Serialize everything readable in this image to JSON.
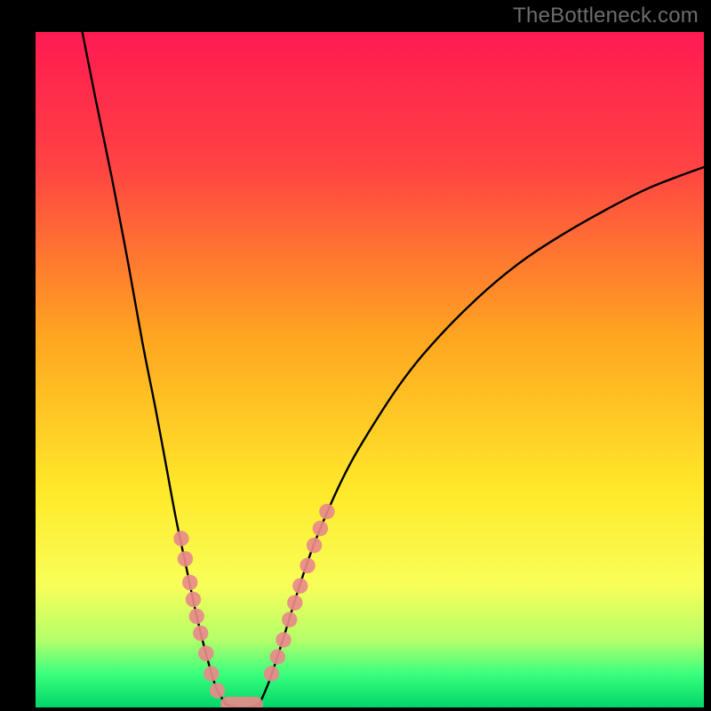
{
  "watermark": "TheBottleneck.com",
  "chart_data": {
    "type": "line",
    "title": "",
    "xlabel": "",
    "ylabel": "",
    "xlim": [
      0,
      100
    ],
    "ylim": [
      0,
      100
    ],
    "background_gradient_stops": [
      {
        "offset": 0,
        "color": "#ff1a52"
      },
      {
        "offset": 20,
        "color": "#ff4343"
      },
      {
        "offset": 45,
        "color": "#ffa520"
      },
      {
        "offset": 68,
        "color": "#ffe92a"
      },
      {
        "offset": 82,
        "color": "#f8ff59"
      },
      {
        "offset": 90,
        "color": "#b4ff6a"
      },
      {
        "offset": 95,
        "color": "#3bff7d"
      },
      {
        "offset": 100,
        "color": "#00d66a"
      }
    ],
    "series": [
      {
        "name": "left-branch",
        "type": "curve",
        "values": [
          {
            "x": 7.0,
            "y": 100.0
          },
          {
            "x": 9.0,
            "y": 90.0
          },
          {
            "x": 11.5,
            "y": 78.0
          },
          {
            "x": 14.0,
            "y": 65.0
          },
          {
            "x": 16.0,
            "y": 54.0
          },
          {
            "x": 18.0,
            "y": 44.0
          },
          {
            "x": 19.5,
            "y": 36.0
          },
          {
            "x": 21.0,
            "y": 28.0
          },
          {
            "x": 22.5,
            "y": 21.0
          },
          {
            "x": 24.0,
            "y": 14.0
          },
          {
            "x": 25.5,
            "y": 8.0
          },
          {
            "x": 27.0,
            "y": 3.0
          },
          {
            "x": 28.5,
            "y": 0.5
          }
        ]
      },
      {
        "name": "valley-floor",
        "type": "curve",
        "values": [
          {
            "x": 28.5,
            "y": 0.5
          },
          {
            "x": 30.0,
            "y": 0.0
          },
          {
            "x": 32.0,
            "y": 0.0
          },
          {
            "x": 33.5,
            "y": 0.5
          }
        ]
      },
      {
        "name": "right-branch",
        "type": "curve",
        "values": [
          {
            "x": 33.5,
            "y": 0.5
          },
          {
            "x": 35.0,
            "y": 4.0
          },
          {
            "x": 37.0,
            "y": 10.0
          },
          {
            "x": 39.5,
            "y": 18.0
          },
          {
            "x": 42.0,
            "y": 25.0
          },
          {
            "x": 46.0,
            "y": 34.0
          },
          {
            "x": 50.0,
            "y": 41.0
          },
          {
            "x": 55.0,
            "y": 48.5
          },
          {
            "x": 60.0,
            "y": 54.5
          },
          {
            "x": 66.0,
            "y": 60.5
          },
          {
            "x": 72.0,
            "y": 65.5
          },
          {
            "x": 78.0,
            "y": 69.5
          },
          {
            "x": 85.0,
            "y": 73.5
          },
          {
            "x": 92.0,
            "y": 77.0
          },
          {
            "x": 100.0,
            "y": 80.0
          }
        ]
      }
    ],
    "markers": [
      {
        "name": "left-dots",
        "color": "#e88a8a",
        "points": [
          {
            "x": 21.8,
            "y": 25.0
          },
          {
            "x": 22.4,
            "y": 22.0
          },
          {
            "x": 23.1,
            "y": 18.5
          },
          {
            "x": 23.6,
            "y": 16.0
          },
          {
            "x": 24.1,
            "y": 13.5
          },
          {
            "x": 24.7,
            "y": 11.0
          },
          {
            "x": 25.5,
            "y": 8.0
          },
          {
            "x": 26.3,
            "y": 5.0
          },
          {
            "x": 27.2,
            "y": 2.5
          }
        ]
      },
      {
        "name": "right-dots",
        "color": "#e88a8a",
        "points": [
          {
            "x": 35.3,
            "y": 5.0
          },
          {
            "x": 36.2,
            "y": 7.5
          },
          {
            "x": 37.1,
            "y": 10.0
          },
          {
            "x": 38.0,
            "y": 13.0
          },
          {
            "x": 38.8,
            "y": 15.5
          },
          {
            "x": 39.6,
            "y": 18.0
          },
          {
            "x": 40.7,
            "y": 21.0
          },
          {
            "x": 41.7,
            "y": 24.0
          },
          {
            "x": 42.6,
            "y": 26.5
          },
          {
            "x": 43.6,
            "y": 29.0
          }
        ]
      },
      {
        "name": "floor-bar",
        "color": "#e88a8a",
        "rect": {
          "x0": 27.7,
          "y0": -0.6,
          "x1": 34.0,
          "y1": 1.6
        }
      }
    ]
  }
}
